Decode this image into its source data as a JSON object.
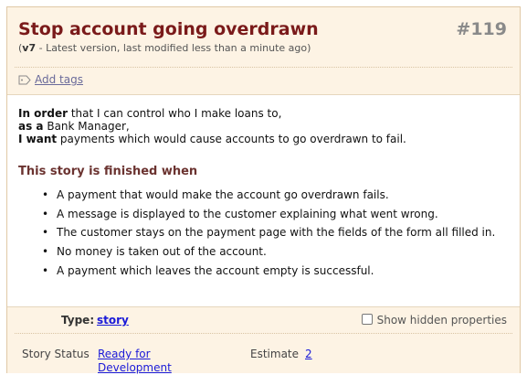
{
  "story": {
    "title": "Stop account going overdrawn",
    "number": "#119",
    "version": "v7",
    "version_note": " - Latest version, last modified less than a minute ago"
  },
  "tags": {
    "add_label": "Add tags",
    "icon": "tag-icon"
  },
  "narrative": {
    "in_order_label": "In order",
    "in_order_text": " that I can control who I make loans to,",
    "as_a_label": "as a",
    "as_a_text": " Bank Manager,",
    "i_want_label": "I want",
    "i_want_text": " payments which would cause accounts to go overdrawn to fail."
  },
  "acceptance": {
    "title": "This story is finished when",
    "items": [
      "A payment that would make the account go overdrawn fails.",
      "A message is displayed to the customer explaining what went wrong.",
      "The customer stays on the payment page with the fields of the form all filled in.",
      "No money is taken out of the account.",
      "A payment which leaves the account empty is successful."
    ]
  },
  "properties": {
    "type_label": "Type:",
    "type_value": "story",
    "show_hidden_label": "Show hidden properties",
    "show_hidden_checked": false,
    "status_label": "Story Status",
    "status_value": "Ready for Development",
    "estimate_label": "Estimate",
    "estimate_value": "2"
  },
  "colors": {
    "title": "#7a1a1a",
    "card_background": "#fdf3e4",
    "link": "#1a1ad8",
    "section_title": "#6b3330"
  }
}
